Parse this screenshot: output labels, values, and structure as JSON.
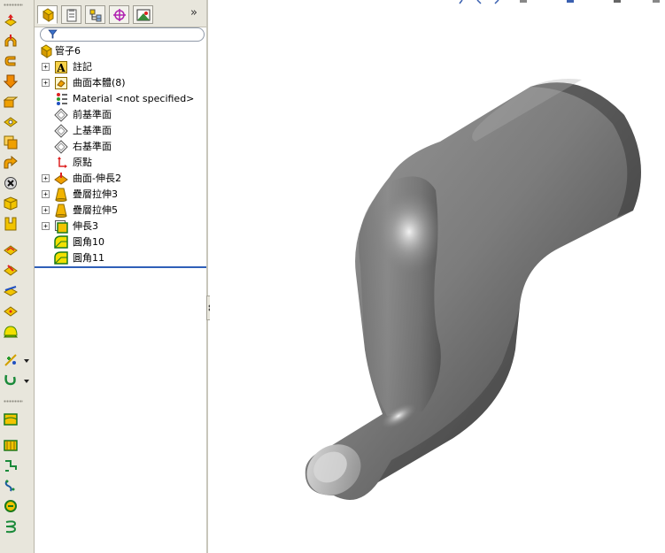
{
  "feature_tree": {
    "root": {
      "label": "管子6",
      "icon": "part-icon"
    },
    "items": [
      {
        "label": "註記",
        "icon": "annotations-icon",
        "expandable": true
      },
      {
        "label": "曲面本體(8)",
        "icon": "surface-bodies-icon",
        "expandable": true
      },
      {
        "label": "Material <not specified>",
        "icon": "material-icon",
        "expandable": false
      },
      {
        "label": "前基準面",
        "icon": "plane-icon",
        "expandable": false
      },
      {
        "label": "上基準面",
        "icon": "plane-icon",
        "expandable": false
      },
      {
        "label": "右基準面",
        "icon": "plane-icon",
        "expandable": false
      },
      {
        "label": "原點",
        "icon": "origin-icon",
        "expandable": false
      },
      {
        "label": "曲面-伸長2",
        "icon": "surface-extrude-icon",
        "expandable": true
      },
      {
        "label": "疊層拉伸3",
        "icon": "loft-icon",
        "expandable": true
      },
      {
        "label": "疊層拉伸5",
        "icon": "loft-icon",
        "expandable": true
      },
      {
        "label": "伸長3",
        "icon": "extrude-icon",
        "expandable": true
      },
      {
        "label": "圓角10",
        "icon": "fillet-icon",
        "expandable": false
      },
      {
        "label": "圓角11",
        "icon": "fillet-icon",
        "expandable": false
      }
    ]
  },
  "tabs": [
    {
      "name": "feature-manager-tab",
      "icon": "feature-manager-icon",
      "active": true
    },
    {
      "name": "property-manager-tab",
      "icon": "property-manager-icon",
      "active": false
    },
    {
      "name": "configuration-manager-tab",
      "icon": "configuration-manager-icon",
      "active": false
    },
    {
      "name": "dimxpert-manager-tab",
      "icon": "dimxpert-icon",
      "active": false
    },
    {
      "name": "display-manager-tab",
      "icon": "display-manager-icon",
      "active": false
    }
  ],
  "tab_more_glyph": "»",
  "expander_glyph": "+",
  "colors": {
    "rollback_bar": "#2f5fb8",
    "toolbar_bg": "#e8e6dc",
    "model_shade_dark": "#3a3a3a",
    "model_shade_light": "#d9d9d9"
  }
}
